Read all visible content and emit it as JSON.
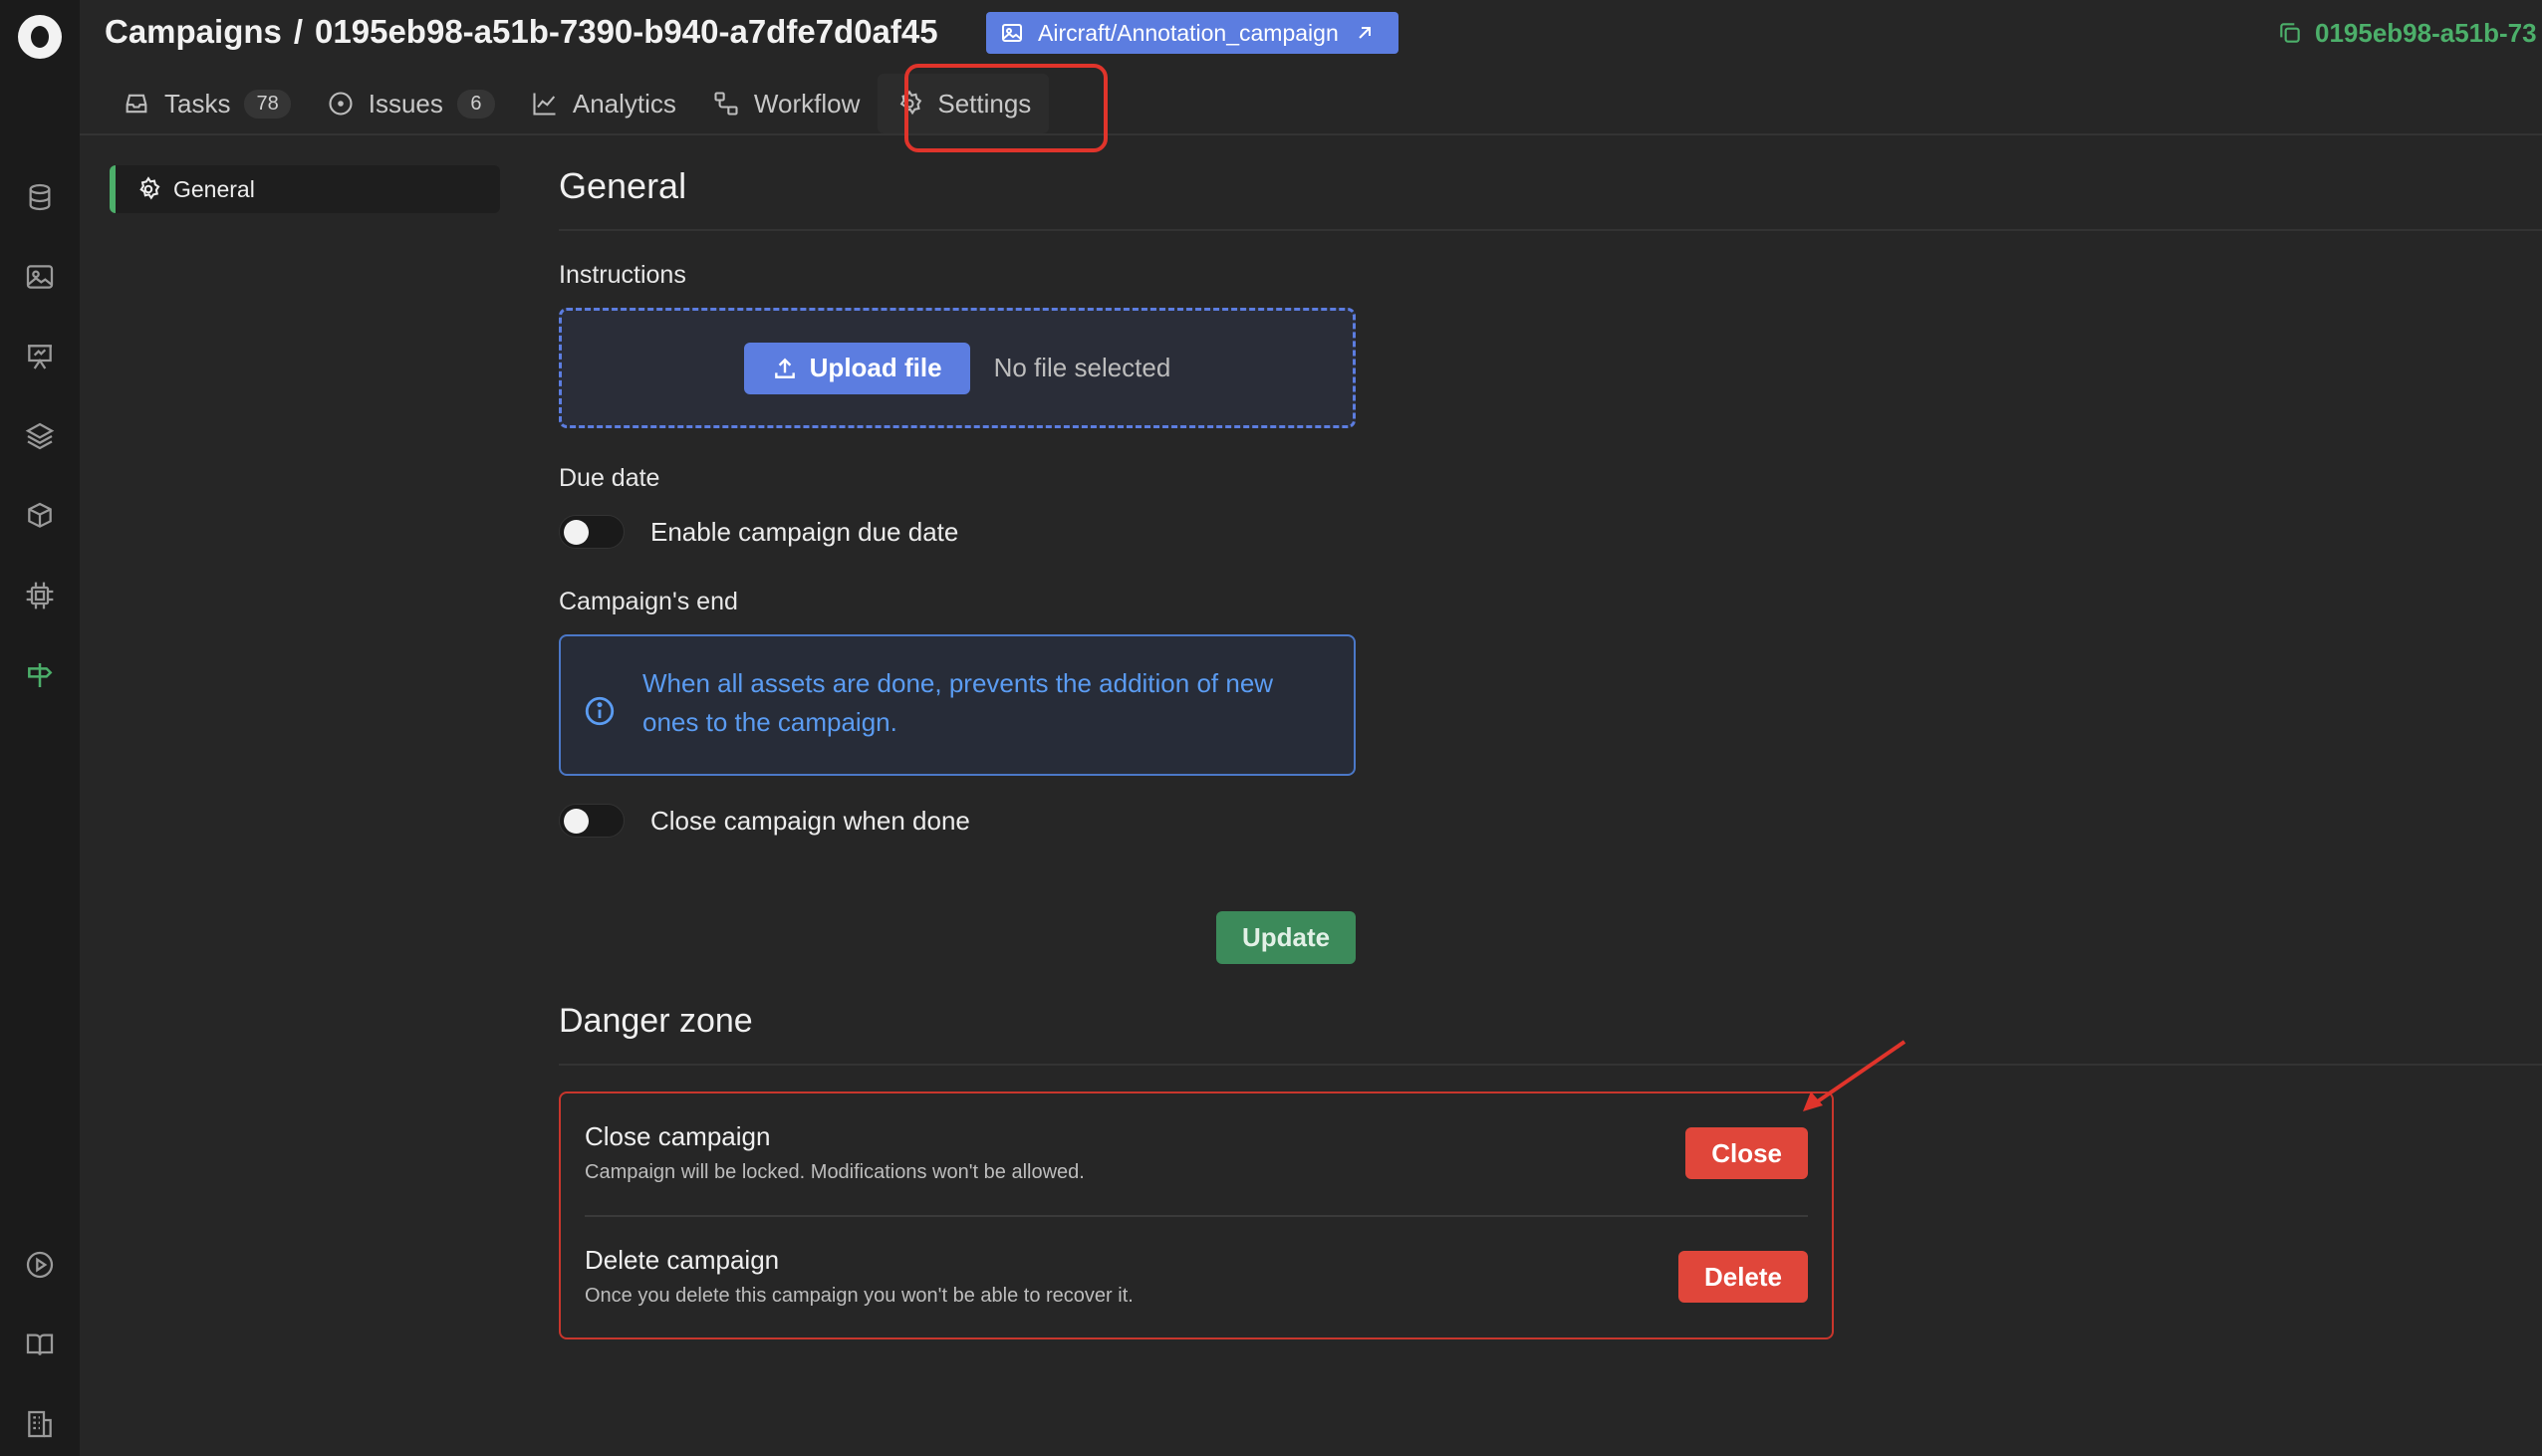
{
  "header": {
    "breadcrumb_root": "Campaigns",
    "breadcrumb_sep": "/",
    "campaign_id": "0195eb98-a51b-7390-b940-a7dfe7d0af45",
    "dataset_chip": "Aircraft/Annotation_campaign",
    "copy_id_text": "0195eb98-a51b-73"
  },
  "tabs": [
    {
      "label": "Tasks",
      "count": "78",
      "icon": "inbox-icon"
    },
    {
      "label": "Issues",
      "count": "6",
      "icon": "issue-icon"
    },
    {
      "label": "Analytics",
      "icon": "chart-icon"
    },
    {
      "label": "Workflow",
      "icon": "workflow-icon"
    },
    {
      "label": "Settings",
      "icon": "gear-icon",
      "active": true
    }
  ],
  "side_nav": {
    "general": "General"
  },
  "main": {
    "title": "General",
    "instructions_label": "Instructions",
    "upload_button": "Upload file",
    "no_file": "No file selected",
    "due_date_label": "Due date",
    "due_date_toggle": "Enable campaign due date",
    "campaign_end_label": "Campaign's end",
    "campaign_end_info": "When all assets are done, prevents the addition of new ones to the campaign.",
    "close_when_done_toggle": "Close campaign when done",
    "update_button": "Update"
  },
  "danger_zone": {
    "title": "Danger zone",
    "close": {
      "title": "Close campaign",
      "desc": "Campaign will be locked. Modifications won't be allowed.",
      "button": "Close"
    },
    "delete": {
      "title": "Delete campaign",
      "desc": "Once you delete this campaign you won't be able to recover it.",
      "button": "Delete"
    }
  },
  "colors": {
    "accent_green": "#4caf6a",
    "accent_blue": "#5c7de0",
    "danger_red": "#e0463a",
    "annotation_red": "#e0342b"
  }
}
